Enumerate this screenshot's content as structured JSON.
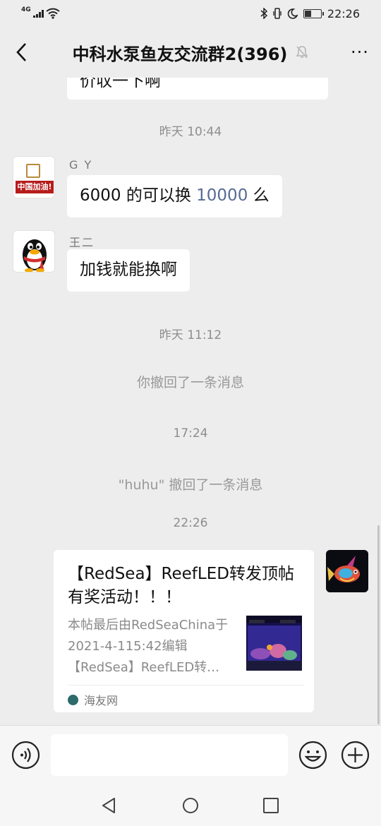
{
  "status_bar": {
    "network": "4G",
    "time": "22:26"
  },
  "header": {
    "title": "中科水泵鱼友交流群2(396)",
    "more_label": "···"
  },
  "chat": {
    "partial_message": "价収一下啊",
    "time_1": "昨天 10:44",
    "msg_gy": {
      "sender": "G Y",
      "text_before": "6000 的可以换 ",
      "text_link": "10000",
      "text_after": " 么",
      "avatar_text": "中国加油!"
    },
    "msg_wang": {
      "sender": "王二",
      "text": "加钱就能换啊"
    },
    "time_2": "昨天 11:12",
    "recall_1": "你撤回了一条消息",
    "time_3": "17:24",
    "recall_2": "\"huhu\" 撤回了一条消息",
    "time_4": "22:26",
    "link_card": {
      "title": "【RedSea】ReefLED转发顶帖有奖活动！！！",
      "description": "本帖最后由RedSeaChina于2021-4-115:42编辑【RedSea】ReefLED转…",
      "source": "海友网"
    }
  },
  "colors": {
    "background": "#ededed",
    "bubble": "#ffffff",
    "link_number": "#576b95"
  }
}
